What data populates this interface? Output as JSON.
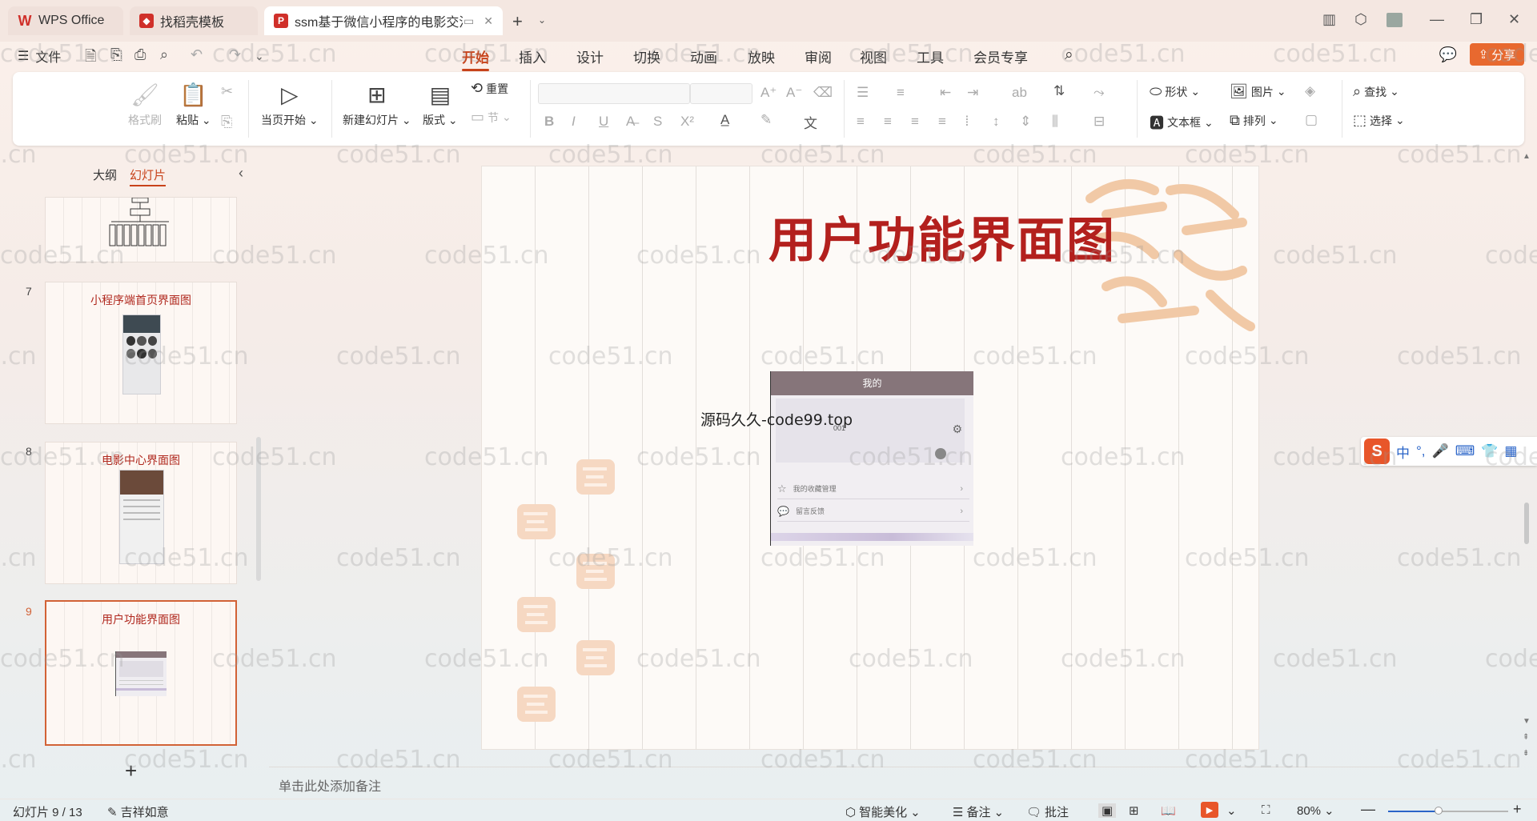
{
  "tabs": [
    {
      "label": "WPS Office",
      "icon": "wps-logo-icon",
      "color": "#d0302a"
    },
    {
      "label": "找稻壳模板",
      "icon": "docer-icon",
      "color": "#d0302a"
    },
    {
      "label": "ssm基于微信小程序的电影交流",
      "icon": "ppt-icon",
      "color": "#d0302a"
    }
  ],
  "menu": {
    "file_label": "文件",
    "items": [
      "开始",
      "插入",
      "设计",
      "切换",
      "动画",
      "放映",
      "审阅",
      "视图",
      "工具",
      "会员专享"
    ],
    "active": "开始",
    "share_label": "分享",
    "accent": "#c8431b"
  },
  "ribbon": {
    "format_painter": "格式刷",
    "paste": "粘贴",
    "play_from_current": "当页开始",
    "new_slide": "新建幻灯片",
    "layout": "版式",
    "reset": "重置",
    "section": "节",
    "shape": "形状",
    "picture": "图片",
    "textbox": "文本框",
    "arrange": "排列",
    "find": "查找",
    "select": "选择"
  },
  "left_panel": {
    "tab_outline": "大纲",
    "tab_slides": "幻灯片",
    "slides": [
      {
        "number": "7",
        "title": "小程序端首页界面图"
      },
      {
        "number": "8",
        "title": "电影中心界面图"
      },
      {
        "number": "9",
        "title": "用户功能界面图",
        "selected": true
      }
    ]
  },
  "slide": {
    "title": "用户功能界面图",
    "text_overlay": "源码久久-code99.top",
    "phone": {
      "header": "我的",
      "user_id": "001",
      "rows": [
        "我的收藏管理",
        "留言反馈"
      ]
    }
  },
  "notes_placeholder": "单击此处添加备注",
  "ime": {
    "lang": "中"
  },
  "status": {
    "slide_counter": "幻灯片 9 / 13",
    "theme": "吉祥如意",
    "beautify": "智能美化",
    "notes": "备注",
    "comments": "批注",
    "zoom": "80%",
    "zoom_level": 0.42
  },
  "watermark": "code51.cn"
}
